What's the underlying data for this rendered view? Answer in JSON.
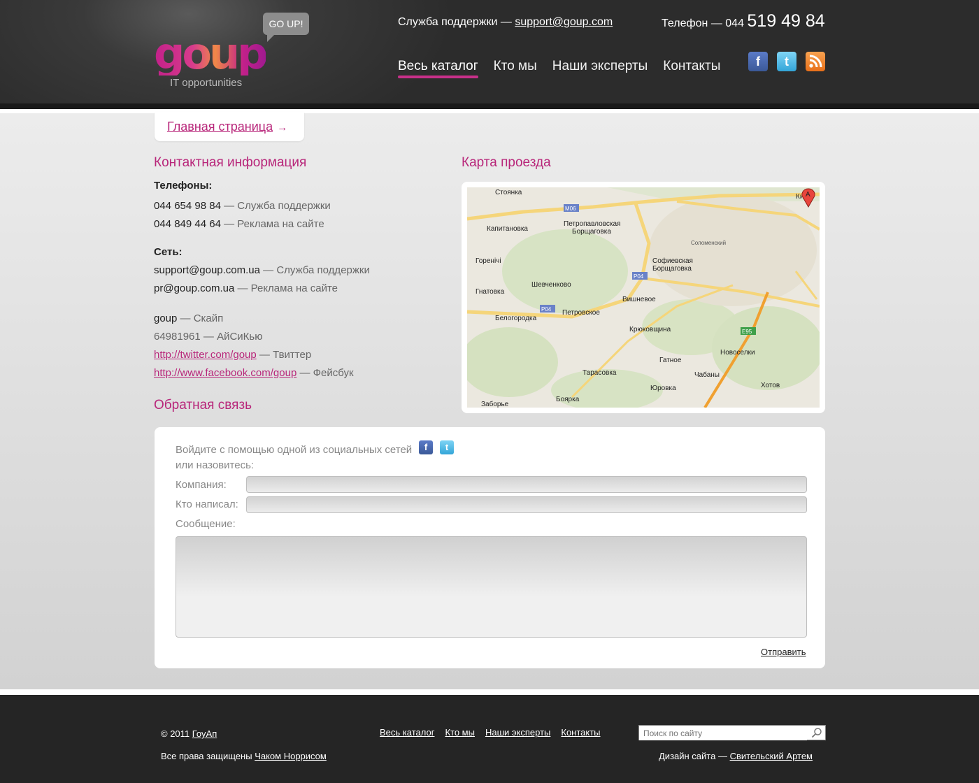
{
  "header": {
    "logo_text": "goup",
    "logo_tagline": "IT opportunities",
    "logo_bubble": "GO UP!",
    "support_label": "Служба поддержки — ",
    "support_email": "support@goup.com",
    "phone_label": "Телефон — 044 ",
    "phone_number": "519 49 84",
    "nav": [
      {
        "label": "Весь каталог",
        "active": true
      },
      {
        "label": "Кто мы"
      },
      {
        "label": "Наши эксперты"
      },
      {
        "label": "Контакты"
      }
    ],
    "social": [
      "facebook-icon",
      "twitter-icon",
      "rss-icon"
    ]
  },
  "breadcrumb": {
    "label": "Главная страница"
  },
  "contacts": {
    "title": "Контактная информация",
    "phones_label": "Телефоны:",
    "phones": [
      {
        "value": "044 654 98 84",
        "desc": " — Служба поддержки"
      },
      {
        "value": "044 849 44 64",
        "desc": " — Реклама на сайте"
      }
    ],
    "net_label": "Сеть:",
    "emails": [
      {
        "value": "support@goup.com.ua",
        "desc": " — Служба поддержки"
      },
      {
        "value": "pr@goup.com.ua",
        "desc": " — Реклама на сайте"
      }
    ],
    "other": [
      {
        "value": "goup",
        "desc": " — Скайп"
      },
      {
        "value": "64981961",
        "desc": " — АйСиКью"
      }
    ],
    "links": [
      {
        "value": "http://twitter.com/goup",
        "desc": " — Твиттер"
      },
      {
        "value": "http://www.facebook.com/goup",
        "desc": " — Фейсбук"
      }
    ]
  },
  "map": {
    "title": "Карта проезда",
    "labels": [
      "Стоянка",
      "Петропавловская Борщаговка",
      "Капитановка",
      "Горенічі",
      "Гнатовка",
      "Шевченково",
      "Белогородка",
      "Петровское",
      "Вишневое",
      "Софиевская Борщаговка",
      "Соломенский",
      "Крюковщина",
      "Новоселки",
      "Гатное",
      "Чабаны",
      "Хотов",
      "Тарасовка",
      "Юровка",
      "Боярка",
      "Заборье",
      "Киев"
    ],
    "roads": [
      "M06",
      "P04",
      "P04",
      "E95"
    ],
    "marker": "A"
  },
  "feedback": {
    "title": "Обратная связь",
    "login_text": "Войдите с помощью одной из социальных сетей",
    "or_text": "или назовитесь:",
    "company_label": "Компания:",
    "author_label": "Кто написал:",
    "message_label": "Сообщение:",
    "company_value": "",
    "author_value": "",
    "submit_label": "Отправить"
  },
  "footer": {
    "copyright": "© 2011 ",
    "copyright_link": "ГоуАп",
    "rights": "Все права защищены ",
    "rights_link": "Чаком Норрисом",
    "nav": [
      "Весь каталог",
      "Кто мы",
      "Наши эксперты",
      "Контакты"
    ],
    "search_placeholder": "Поиск по сайту",
    "design_label": "Дизайн сайта — ",
    "designer": "Свительский Артем"
  },
  "colors": {
    "accent": "#b8267a",
    "header_bg": "#2c2c2c",
    "footer_bg": "#252525"
  }
}
